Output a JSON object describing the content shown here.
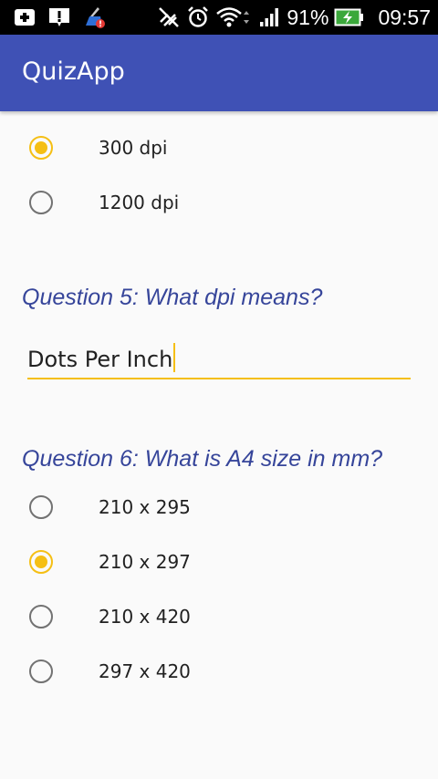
{
  "status_bar": {
    "battery": "91%",
    "time": "09:57",
    "icons": [
      "add-box-icon",
      "alert-icon",
      "cleaner-icon",
      "mute-icon",
      "alarm-icon",
      "wifi-icon",
      "signal-icon",
      "battery-charging-icon"
    ]
  },
  "app_bar": {
    "title": "QuizApp"
  },
  "question4_options": [
    {
      "label": "300 dpi",
      "checked": true
    },
    {
      "label": "1200 dpi",
      "checked": false
    }
  ],
  "question5": {
    "title": "Question 5: What dpi means?",
    "answer": "Dots Per Inch"
  },
  "question6": {
    "title": "Question 6: What is A4 size in mm?",
    "options": [
      {
        "label": "210 x 295",
        "checked": false
      },
      {
        "label": "210 x 297",
        "checked": true
      },
      {
        "label": "210 x 420",
        "checked": false
      },
      {
        "label": "297 x 420",
        "checked": false
      }
    ]
  },
  "colors": {
    "primary": "#3f51b5",
    "accent": "#f5bf14",
    "question_text": "#36459a"
  }
}
